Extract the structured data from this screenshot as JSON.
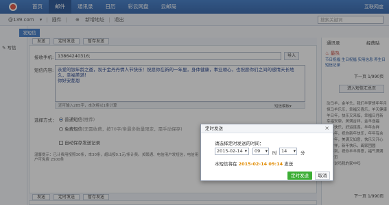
{
  "nav": {
    "tabs": [
      "首页",
      "邮件",
      "通讯录",
      "日历",
      "彩云网盘",
      "云邮局"
    ],
    "active_index": 1,
    "right_label": "互联网度"
  },
  "subbar": {
    "account": "@139.com",
    "account_arrow": "▾",
    "plugin": "插件",
    "new_address_icon": "⊕",
    "new_address": "新增地址",
    "logout": "退出",
    "search_placeholder": "搜索关键词"
  },
  "sidebar": {
    "compose_label": "发短信",
    "write_label": "写信"
  },
  "toolbar": {
    "send": "发送",
    "scheduled_send": "定时发送",
    "save_draft": "暂存发送"
  },
  "form": {
    "recipient_label": "接收手机:",
    "recipient_value": "13864240316;",
    "import_label": "导入",
    "content_label": "短信内容:",
    "content_lines": [
      "亲爱的银年龄之邀，视于金丹丹情人节快乐！祝愿你在新的一年里，身体健康，事业顺心，也祝愿你们之间的感情天长地久，幸福美满！",
      "你好安都恩"
    ],
    "counter_text": "还可输入285字，本次将以1条计算",
    "template_label": "短信模板▾",
    "send_mode_label": "选择方式：",
    "normal_sms_label": "普通短信",
    "normal_sms_note": "(推荐)",
    "free_sms_label": "免费短信",
    "free_sms_note": "(无需收费，按70字/条最多数量限定，需手动保存)",
    "auto_save_label": "自动保存发送记录",
    "notice_text": "温馨提示：已计费用按照30条，本30条，超出按0.1元/条计费。关联通、电信用户发短信，电信用户可免费",
    "notice_text2": "2500条"
  },
  "right_panel": {
    "tabs": [
      "通讯录",
      "经典贴"
    ],
    "section": "最热",
    "items": [
      "节日祝福 生日祝福 实用信息 养生日",
      "短信记录"
    ],
    "page_text": "下一页",
    "page_num": "1/990页",
    "enter_button": "进入短信汇总页",
    "snippets": [
      "动马羊，金羊头，我们羊梦想年年月",
      "恒马羊乐乐，幸福又喜乐，羊天健康",
      "羊日年，快乐又来临，幸福日月新",
      "幸福安康，美满吉祥，金羊送福",
      "新年快乐，好运连连，羊年吉祥",
      "愿马年，祝你新年快乐，年年有余",
      "金羊年，美满又如意，快乐又开心",
      "羊吉祥，新年快乐，阖家团圆",
      "羊年到，祝你羊羊得意，福气满满",
      "下一页",
      "你一说吗我的家中吗"
    ]
  },
  "dialog": {
    "title": "定时发送",
    "prompt": "请选择定时发送的时间：",
    "date": "2015-02-14",
    "hour": "09",
    "hour_unit": "时",
    "minute": "14",
    "minute_unit": "分",
    "info_prefix": "本短信将在",
    "info_time": "2015-02-14 09:14",
    "info_suffix": "发送",
    "ok_label": "定时发送",
    "cancel_label": "取消",
    "close_glyph": "×"
  }
}
